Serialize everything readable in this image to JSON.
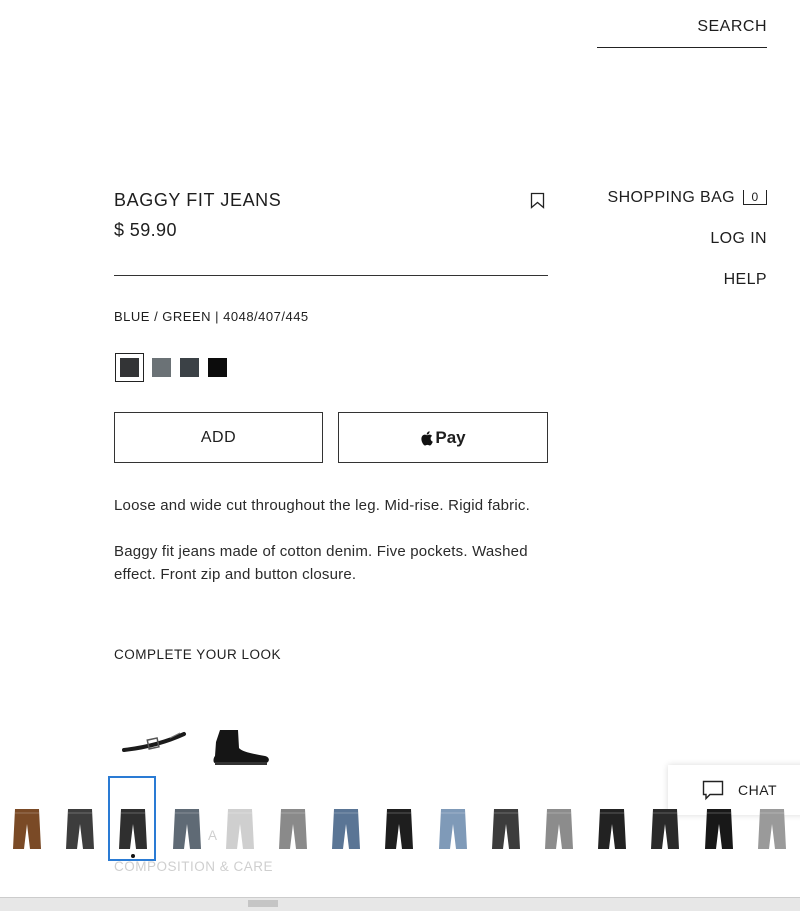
{
  "header": {
    "search_label": "SEARCH",
    "nav": {
      "shopping_bag_label": "SHOPPING BAG",
      "bag_count": "0",
      "login_label": "LOG IN",
      "help_label": "HELP"
    }
  },
  "product": {
    "title": "BAGGY FIT JEANS",
    "price": "$ 59.90",
    "color_line": "BLUE / GREEN | 4048/407/445",
    "swatches": [
      {
        "color": "#333436",
        "selected": true
      },
      {
        "color": "#6b7276",
        "selected": false
      },
      {
        "color": "#3b4146",
        "selected": false
      },
      {
        "color": "#0c0c0c",
        "selected": false
      }
    ],
    "add_label": "ADD",
    "apple_pay_label": "Pay",
    "description_1": "Loose and wide cut throughout the leg. Mid-rise. Rigid fabric.",
    "description_2": "Baggy fit jeans made of cotton denim. Five pockets. Washed effect. Front zip and button closure."
  },
  "complete_look": {
    "heading": "COMPLETE YOUR LOOK",
    "items": [
      "belt-icon",
      "boot-icon"
    ]
  },
  "ghost_text": {
    "partial_row": "A",
    "composition": "COMPOSITION & CARE"
  },
  "chat": {
    "label": "CHAT"
  },
  "variant_strip": {
    "selected_index": 2,
    "thumbnails": [
      {
        "color": "#7a4a26"
      },
      {
        "color": "#3d3d3d"
      },
      {
        "color": "#2f2f2f"
      },
      {
        "color": "#5f6a75"
      },
      {
        "color": "#cfcfcf"
      },
      {
        "color": "#8a8a8a"
      },
      {
        "color": "#5a7595"
      },
      {
        "color": "#1e1e1e"
      },
      {
        "color": "#7f9ab8"
      },
      {
        "color": "#3c3c3c"
      },
      {
        "color": "#8c8c8c"
      },
      {
        "color": "#222222"
      },
      {
        "color": "#2a2a2a"
      },
      {
        "color": "#181818"
      },
      {
        "color": "#9a9a9a"
      }
    ]
  }
}
